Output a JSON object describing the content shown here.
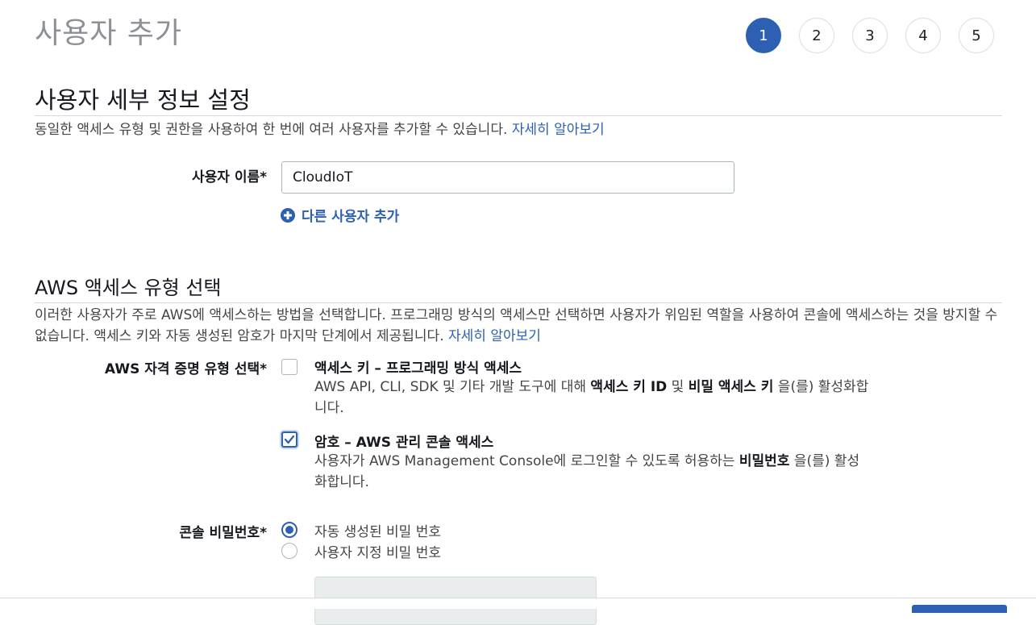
{
  "header": {
    "title": "사용자 추가"
  },
  "steps": [
    "1",
    "2",
    "3",
    "4",
    "5"
  ],
  "user_details": {
    "title": "사용자 세부 정보 설정",
    "description": "동일한 액세스 유형 및 권한을 사용하여 한 번에 여러 사용자를 추가할 수 있습니다.",
    "learn_more": "자세히 알아보기",
    "username_label": "사용자 이름*",
    "username_value": "CloudIoT",
    "add_user_label": "다른 사용자 추가"
  },
  "access_type": {
    "title": "AWS 액세스 유형 선택",
    "description": "이러한 사용자가 주로 AWS에 액세스하는 방법을 선택합니다. 프로그래밍 방식의 액세스만 선택하면 사용자가 위임된 역할을 사용하여 콘솔에 액세스하는 것을 방지할 수 없습니다. 액세스 키와 자동 생성된 암호가 마지막 단계에서 제공됩니다.",
    "learn_more": "자세히 알아보기",
    "credential_label": "AWS 자격 증명 유형 선택*",
    "options": [
      {
        "title": "액세스 키 – 프로그래밍 방식 액세스",
        "desc_pre": "AWS API, CLI, SDK 및 기타 개발 도구에 대해 ",
        "desc_bold1": "액세스 키 ID",
        "desc_mid": " 및 ",
        "desc_bold2": "비밀 액세스 키",
        "desc_post": " 을(를) 활성화합니다.",
        "checked": false
      },
      {
        "title": "암호 – AWS 관리 콘솔 액세스",
        "desc_pre": "사용자가 AWS Management Console에 로그인할 수 있도록 허용하는 ",
        "desc_bold1": "비밀번호",
        "desc_post": " 을(를) 활성화합니다.",
        "checked": true
      }
    ],
    "console_password_label": "콘솔 비밀번호*",
    "password_options": [
      "자동 생성된 비밀 번호",
      "사용자 지정 비밀 번호"
    ]
  },
  "colors": {
    "accent": "#2d5fb3",
    "muted_title": "#8d9096",
    "border": "#aab7b8"
  }
}
